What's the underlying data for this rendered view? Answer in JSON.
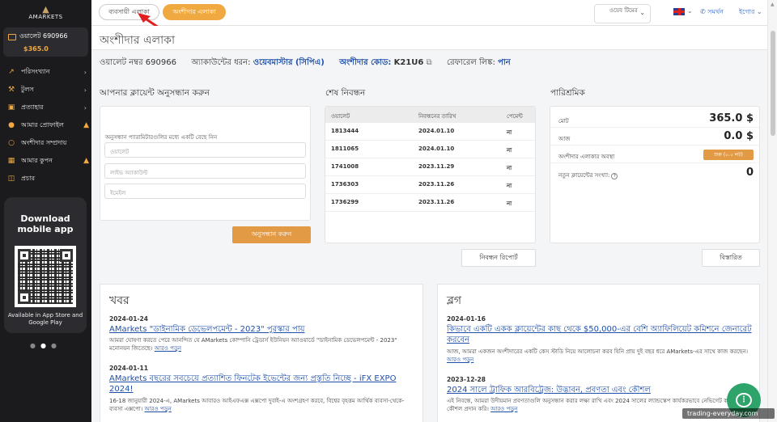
{
  "sidebar": {
    "logo": "AMARKETS",
    "wallet": {
      "label": "ওয়ালেট 690966",
      "balance": "$365.0"
    },
    "items": [
      {
        "label": "পরিসংখ্যান",
        "icon": "chart-icon",
        "trail": "chevron"
      },
      {
        "label": "টুলস",
        "icon": "tools-icon",
        "trail": "chevron"
      },
      {
        "label": "প্রত্যাহার",
        "icon": "withdraw-icon",
        "trail": "chevron"
      },
      {
        "label": "আমার প্রোফাইল",
        "icon": "user-icon",
        "trail": "flame"
      },
      {
        "label": "অংশীদার সম্প্রদায়",
        "icon": "community-icon",
        "trail": ""
      },
      {
        "label": "আমার কুপন",
        "icon": "coupon-icon",
        "trail": "flame"
      },
      {
        "label": "প্রচার",
        "icon": "promo-icon",
        "trail": ""
      }
    ],
    "app_promo": {
      "title": "Download mobile app",
      "subtitle": "Available in App Store and Google Play"
    }
  },
  "header": {
    "tab_trader": "ব্যবসায়ী এলাকা",
    "tab_partner": "অংশীদার এলাকা",
    "language_select": "ওয়েব টিমের",
    "support": "সমর্থন",
    "login": "ইগোর"
  },
  "page": {
    "title": "অংশীদার এলাকা",
    "wallet_label": "ওয়ালেট নম্বর",
    "wallet_number": "690966",
    "account_type_label": "অ্যাকাউন্টের ধরন:",
    "account_type": "ওয়েবমাস্টার (সিপিএ)",
    "partner_code_label": "অংশীদার কোড:",
    "partner_code": "K21U6",
    "referral_label": "রেফারেল লিঙ্ক:",
    "referral_link": "পান"
  },
  "client_search": {
    "title": "আপনার ক্লায়েন্ট অনুসন্ধান করুন",
    "hint": "অনুসন্ধান প্যারামিটারগুলির মধ্যে একটি বেছে নিন",
    "wallet_placeholder": "ওয়ালেট",
    "account_placeholder": "লাইভ অ্যাকাউন্ট",
    "email_placeholder": "ইমেইল",
    "search_button": "অনুসন্ধান করুন"
  },
  "registrations": {
    "title": "শেষ নিবন্ধন",
    "columns": [
      "ওয়ালেট",
      "নিবন্ধনের তারিখ",
      "পেমেন্ট"
    ],
    "rows": [
      [
        "1813444",
        "2024.01.10",
        "না"
      ],
      [
        "1811065",
        "2024.01.10",
        "না"
      ],
      [
        "1741008",
        "2023.11.29",
        "না"
      ],
      [
        "1736303",
        "2023.11.26",
        "না"
      ],
      [
        "1736299",
        "2023.11.26",
        "না"
      ]
    ],
    "report_button": "নিবন্ধন রিপোর্ট"
  },
  "remuneration": {
    "title": "পারিশ্রমিক",
    "total_label": "মোট",
    "total_value": "365.0 $",
    "today_label": "আজ",
    "today_value": "0.0 $",
    "status_label": "অংশীদার এলাকার অবস্থা",
    "status_value": "শুরু (০.০ লট)",
    "new_clients_label": "নতুন ক্লায়েন্টের সংখ্যা:",
    "new_clients_value": "0",
    "details_button": "বিস্তারিত"
  },
  "news": {
    "title": "খবর",
    "items": [
      {
        "date": "2024-01-24",
        "title": "AMarkets \"ডাইনামিক ডেভেলপমেন্ট - 2023\" পুরস্কার পায়",
        "text": "আমরা ঘোষণা করতে পেরে আনন্দিত যে AMarkets কোম্পানি ট্রেডার্স ইউনিয়ন অ্যাওয়ার্ডে \"ডাইনামিক ডেভেলপমেন্ট - 2023\" মনোনয়ন জিতেছে।",
        "more": "আরও পড়ুন"
      },
      {
        "date": "2024-01-11",
        "title": "AMarkets বছরের সবচেয়ে প্রত্যাশিত ফিনটেক ইভেন্টের জন্য প্রস্তুতি নিচ্ছে - iFX EXPO 2024!",
        "text": "16-18 জানুয়ারী 2024-এ, AMarkets আবারও আইএফএক্স এক্সপো দুবাই-এ অংশগ্রহণ করবে, বিশ্বের বৃহত্তম আর্থিক ব্যবসা-থেকে-ব্যবসা এক্সপো।",
        "more": "আরও পড়ুন"
      }
    ]
  },
  "blog": {
    "title": "ব্লগ",
    "items": [
      {
        "date": "2024-01-16",
        "title": "কিভাবে একটি একক ক্লায়েন্টের কাছ থেকে $50,000-এর বেশি অ্যাফিলিয়েট কমিশনে জেনারেট করবেন",
        "text": "আজ, আমরা একজন অংশীদারের একটি কেস স্টাডি নিয়ে আলোচনা করব যিনি প্রায় দুই বছর ধরে AMarkets-এর সাথে কাজ করছেন।",
        "more": "আরও পড়ুন"
      },
      {
        "date": "2023-12-28",
        "title": "2024 সালে ট্রাফিক আরবিট্রেজ: উদ্ভাবন, প্রবণতা এবং কৌশল",
        "text": "এই নিবন্ধে, আমরা উদীয়মান প্রবণতাগুলি অনুসন্ধান করার লক্ষ্য রাখি এবং 2024 সালের ল্যান্ডস্কেপ কার্যকরভাবে নেভিগেট করার কৌশল প্রদান করি।",
        "more": "আরও পড়ুন"
      }
    ]
  },
  "watermark": "trading-everyday.com"
}
